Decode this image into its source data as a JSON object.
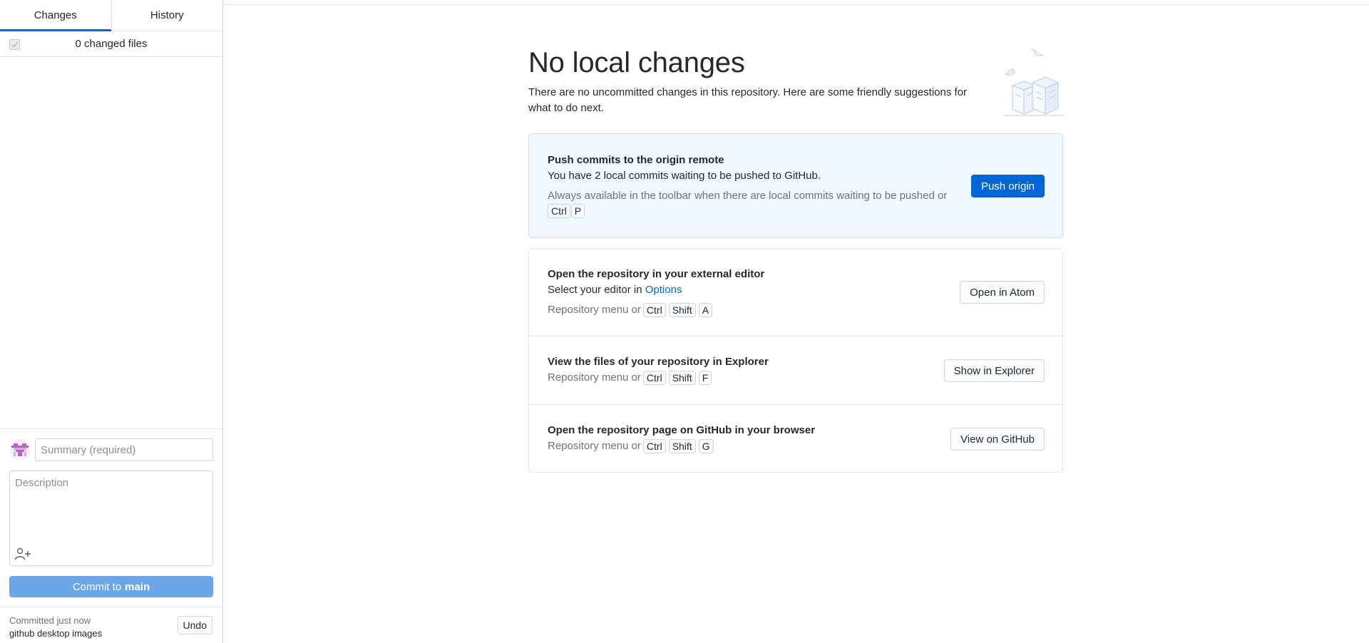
{
  "sidebar": {
    "tabs": [
      {
        "label": "Changes",
        "active": true
      },
      {
        "label": "History",
        "active": false
      }
    ],
    "changed_files_label": "0 changed files",
    "commit": {
      "summary_placeholder": "Summary (required)",
      "description_placeholder": "Description",
      "button_prefix": "Commit to",
      "branch": "main"
    },
    "last_commit": {
      "time": "Committed just now",
      "message": "github desktop images",
      "undo_label": "Undo"
    }
  },
  "main": {
    "title": "No local changes",
    "lead": "There are no uncommitted changes in this repository. Here are some friendly suggestions for what to do next.",
    "push": {
      "title": "Push commits to the origin remote",
      "description": "You have 2 local commits waiting to be pushed to GitHub.",
      "hint": "Always available in the toolbar when there are local commits waiting to be pushed or",
      "keys": [
        "Ctrl",
        "P"
      ],
      "button": "Push origin"
    },
    "editor": {
      "title": "Open the repository in your external editor",
      "description_prefix": "Select your editor in",
      "description_link": "Options",
      "hint": "Repository menu or",
      "keys": [
        "Ctrl",
        "Shift",
        "A"
      ],
      "button": "Open in Atom"
    },
    "explorer": {
      "title": "View the files of your repository in Explorer",
      "hint": "Repository menu or",
      "keys": [
        "Ctrl",
        "Shift",
        "F"
      ],
      "button": "Show in Explorer"
    },
    "github": {
      "title": "Open the repository page on GitHub in your browser",
      "hint": "Repository menu or",
      "keys": [
        "Ctrl",
        "Shift",
        "G"
      ],
      "button": "View on GitHub"
    }
  },
  "colors": {
    "accent": "#0366d6",
    "commit_button": "#6aa6e8",
    "push_card_bg": "#f1f8ff"
  },
  "icons": [
    "checkbox-checked-icon",
    "user-avatar-icon",
    "add-coauthor-icon",
    "empty-repo-illustration"
  ]
}
